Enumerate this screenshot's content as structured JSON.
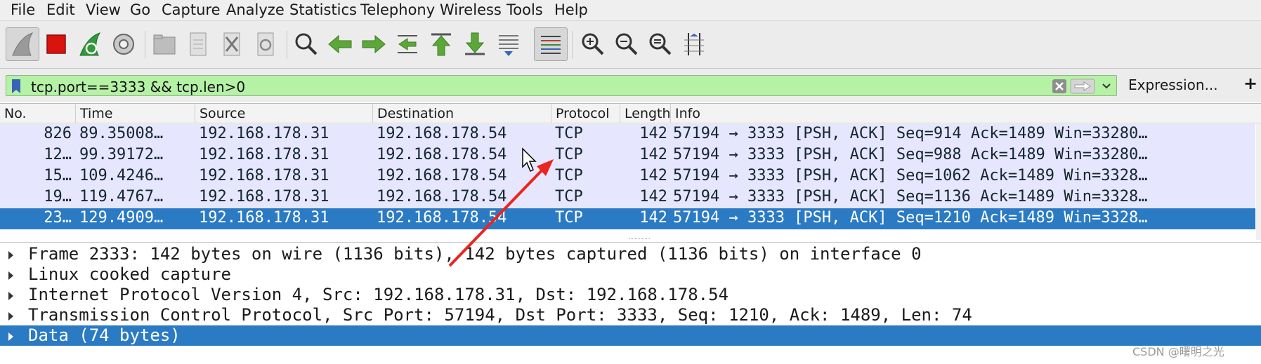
{
  "menu": {
    "items": [
      "File",
      "Edit",
      "View",
      "Go",
      "Capture",
      "Analyze",
      "Statistics",
      "Telephony",
      "Wireless",
      "Tools",
      "Help"
    ]
  },
  "toolbar": {
    "icons": [
      "start-capture",
      "stop-capture",
      "restart-capture",
      "capture-options",
      "open-file",
      "save-file",
      "close-file",
      "reload-file",
      "find-packet",
      "go-back",
      "go-forward",
      "go-to-packet",
      "go-first",
      "go-last",
      "auto-scroll",
      "colorize",
      "zoom-in",
      "zoom-out",
      "zoom-normal",
      "resize-columns"
    ]
  },
  "filter": {
    "value": "tcp.port==3333 && tcp.len>0",
    "expression_label": "Expression...",
    "plus_label": "+"
  },
  "packet_list": {
    "columns": [
      "No.",
      "Time",
      "Source",
      "Destination",
      "Protocol",
      "Length",
      "Info"
    ],
    "rows": [
      {
        "no": "826",
        "time": "89.35008…",
        "source": "192.168.178.31",
        "destination": "192.168.178.54",
        "protocol": "TCP",
        "length": "142",
        "info": "57194 → 3333 [PSH, ACK] Seq=914 Ack=1489 Win=33280…"
      },
      {
        "no": "12…",
        "time": "99.39172…",
        "source": "192.168.178.31",
        "destination": "192.168.178.54",
        "protocol": "TCP",
        "length": "142",
        "info": "57194 → 3333 [PSH, ACK] Seq=988 Ack=1489 Win=33280…"
      },
      {
        "no": "15…",
        "time": "109.4246…",
        "source": "192.168.178.31",
        "destination": "192.168.178.54",
        "protocol": "TCP",
        "length": "142",
        "info": "57194 → 3333 [PSH, ACK] Seq=1062 Ack=1489 Win=3328…"
      },
      {
        "no": "19…",
        "time": "119.4767…",
        "source": "192.168.178.31",
        "destination": "192.168.178.54",
        "protocol": "TCP",
        "length": "142",
        "info": "57194 → 3333 [PSH, ACK] Seq=1136 Ack=1489 Win=3328…"
      },
      {
        "no": "23…",
        "time": "129.4909…",
        "source": "192.168.178.31",
        "destination": "192.168.178.54",
        "protocol": "TCP",
        "length": "142",
        "info": "57194 → 3333 [PSH, ACK] Seq=1210 Ack=1489 Win=3328…"
      }
    ],
    "selected_row": 4
  },
  "details": {
    "rows": [
      "Frame 2333: 142 bytes on wire (1136 bits), 142 bytes captured (1136 bits) on interface 0",
      "Linux cooked capture",
      "Internet Protocol Version 4, Src: 192.168.178.31, Dst: 192.168.178.54",
      "Transmission Control Protocol, Src Port: 57194, Dst Port: 3333, Seq: 1210, Ack: 1489, Len: 74",
      "Data (74 bytes)"
    ],
    "selected_row": 4
  },
  "watermark": "CSDN @曙明之光",
  "colors": {
    "filter_valid_bg": "#b6f2a6",
    "row_tcp_bg": "#e7e6ff",
    "selection_bg": "#2b7ac4",
    "annotation_arrow": "#e8261f"
  }
}
